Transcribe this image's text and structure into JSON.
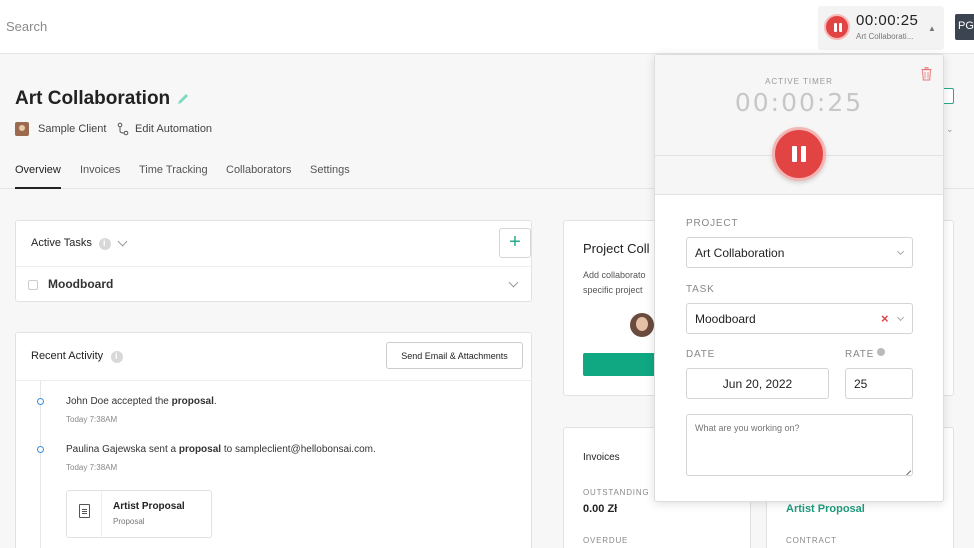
{
  "topbar": {
    "search_placeholder": "Search",
    "timer": {
      "time": "00:00:25",
      "project": "Art Collaborati..."
    },
    "user_initials": "PG"
  },
  "project": {
    "title": "Art Collaboration",
    "client": "Sample Client",
    "automation": "Edit Automation"
  },
  "tabs": [
    "Overview",
    "Invoices",
    "Time Tracking",
    "Collaborators",
    "Settings"
  ],
  "active_tasks": {
    "title": "Active Tasks",
    "tasks": [
      "Moodboard"
    ]
  },
  "recent_activity": {
    "title": "Recent Activity",
    "send_button": "Send Email & Attachments",
    "items": [
      {
        "pre": "John Doe accepted the ",
        "bold": "proposal",
        "post": ".",
        "time": "Today 7:38AM"
      },
      {
        "pre": "Paulina Gajewska sent a ",
        "bold": "proposal",
        "post": " to sampleclient@hellobonsai.com.",
        "time": "Today 7:38AM"
      }
    ],
    "attachment": {
      "title": "Artist Proposal",
      "type": "Proposal"
    }
  },
  "collaborators": {
    "title": "Project Coll",
    "desc": "Add collaborato specific project"
  },
  "invoices": {
    "title": "Invoices",
    "outstanding_label": "OUTSTANDING",
    "outstanding_value": "0.00 Zł",
    "overdue_label": "OVERDUE",
    "proposal_link": "Artist Proposal",
    "contract_label": "CONTRACT"
  },
  "timer_popover": {
    "label": "ACTIVE TIMER",
    "hours": "00",
    "minutes": "00",
    "seconds": "25",
    "project_label": "PROJECT",
    "project_value": "Art Collaboration",
    "task_label": "TASK",
    "task_value": "Moodboard",
    "clear_glyph": "×",
    "date_label": "DATE",
    "date_value": "Jun 20, 2022",
    "rate_label": "RATE",
    "rate_value": "25",
    "notes_placeholder": "What are you working on?"
  },
  "colors": {
    "accent": "#0fa882",
    "timer_red": "#e24444"
  }
}
